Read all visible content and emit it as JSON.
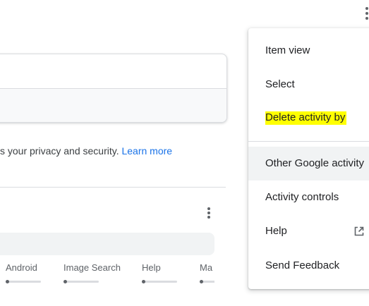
{
  "privacy_notice": {
    "text": "s your privacy and security. ",
    "link_label": "Learn more"
  },
  "product_filters": [
    "Android",
    "Image Search",
    "Help",
    "Ma"
  ],
  "menu": {
    "items": [
      {
        "label": "Item view"
      },
      {
        "label": "Select"
      },
      {
        "label": "Delete activity by"
      },
      {
        "label": "Other Google activity"
      },
      {
        "label": "Activity controls"
      },
      {
        "label": "Help"
      },
      {
        "label": "Send Feedback"
      }
    ],
    "highlight_color": "#ffff00",
    "active_item": "Other Google activity"
  },
  "icons": {
    "top_menu": "more-vert-icon",
    "bundle_menu": "more-vert-icon",
    "help_external": "open-in-new-icon"
  }
}
